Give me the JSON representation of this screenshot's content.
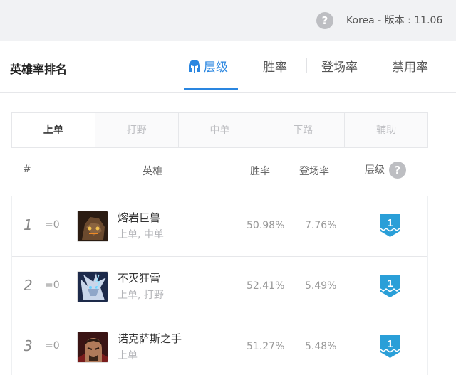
{
  "header": {
    "help_symbol": "?",
    "region_text": "Korea - 版本 : 11.06"
  },
  "card": {
    "title": "英雄率排名",
    "tabs": [
      {
        "label": "层级",
        "active": true,
        "icon": "helmet-icon"
      },
      {
        "label": "胜率",
        "active": false
      },
      {
        "label": "登场率",
        "active": false
      },
      {
        "label": "禁用率",
        "active": false
      }
    ]
  },
  "lanes": [
    {
      "label": "上单",
      "active": true
    },
    {
      "label": "打野",
      "active": false
    },
    {
      "label": "中单",
      "active": false
    },
    {
      "label": "下路",
      "active": false
    },
    {
      "label": "辅助",
      "active": false
    }
  ],
  "columns": {
    "rank": "#",
    "hero": "英雄",
    "win": "胜率",
    "pick": "登场率",
    "tier": "层级",
    "tier_help": "?"
  },
  "rows": [
    {
      "rank": "1",
      "delta": "=0",
      "name": "熔岩巨兽",
      "roles": "上单, 中单",
      "win": "50.98%",
      "pick": "7.76%",
      "tier": "1",
      "avatar": "malphite-portrait"
    },
    {
      "rank": "2",
      "delta": "=0",
      "name": "不灭狂雷",
      "roles": "上单, 打野",
      "win": "52.41%",
      "pick": "5.49%",
      "tier": "1",
      "avatar": "volibear-portrait"
    },
    {
      "rank": "3",
      "delta": "=0",
      "name": "诺克萨斯之手",
      "roles": "上单",
      "win": "51.27%",
      "pick": "5.48%",
      "tier": "1",
      "avatar": "darius-portrait"
    }
  ],
  "colors": {
    "accent": "#2a86e0",
    "tier_badge": "#2a9fd8"
  }
}
